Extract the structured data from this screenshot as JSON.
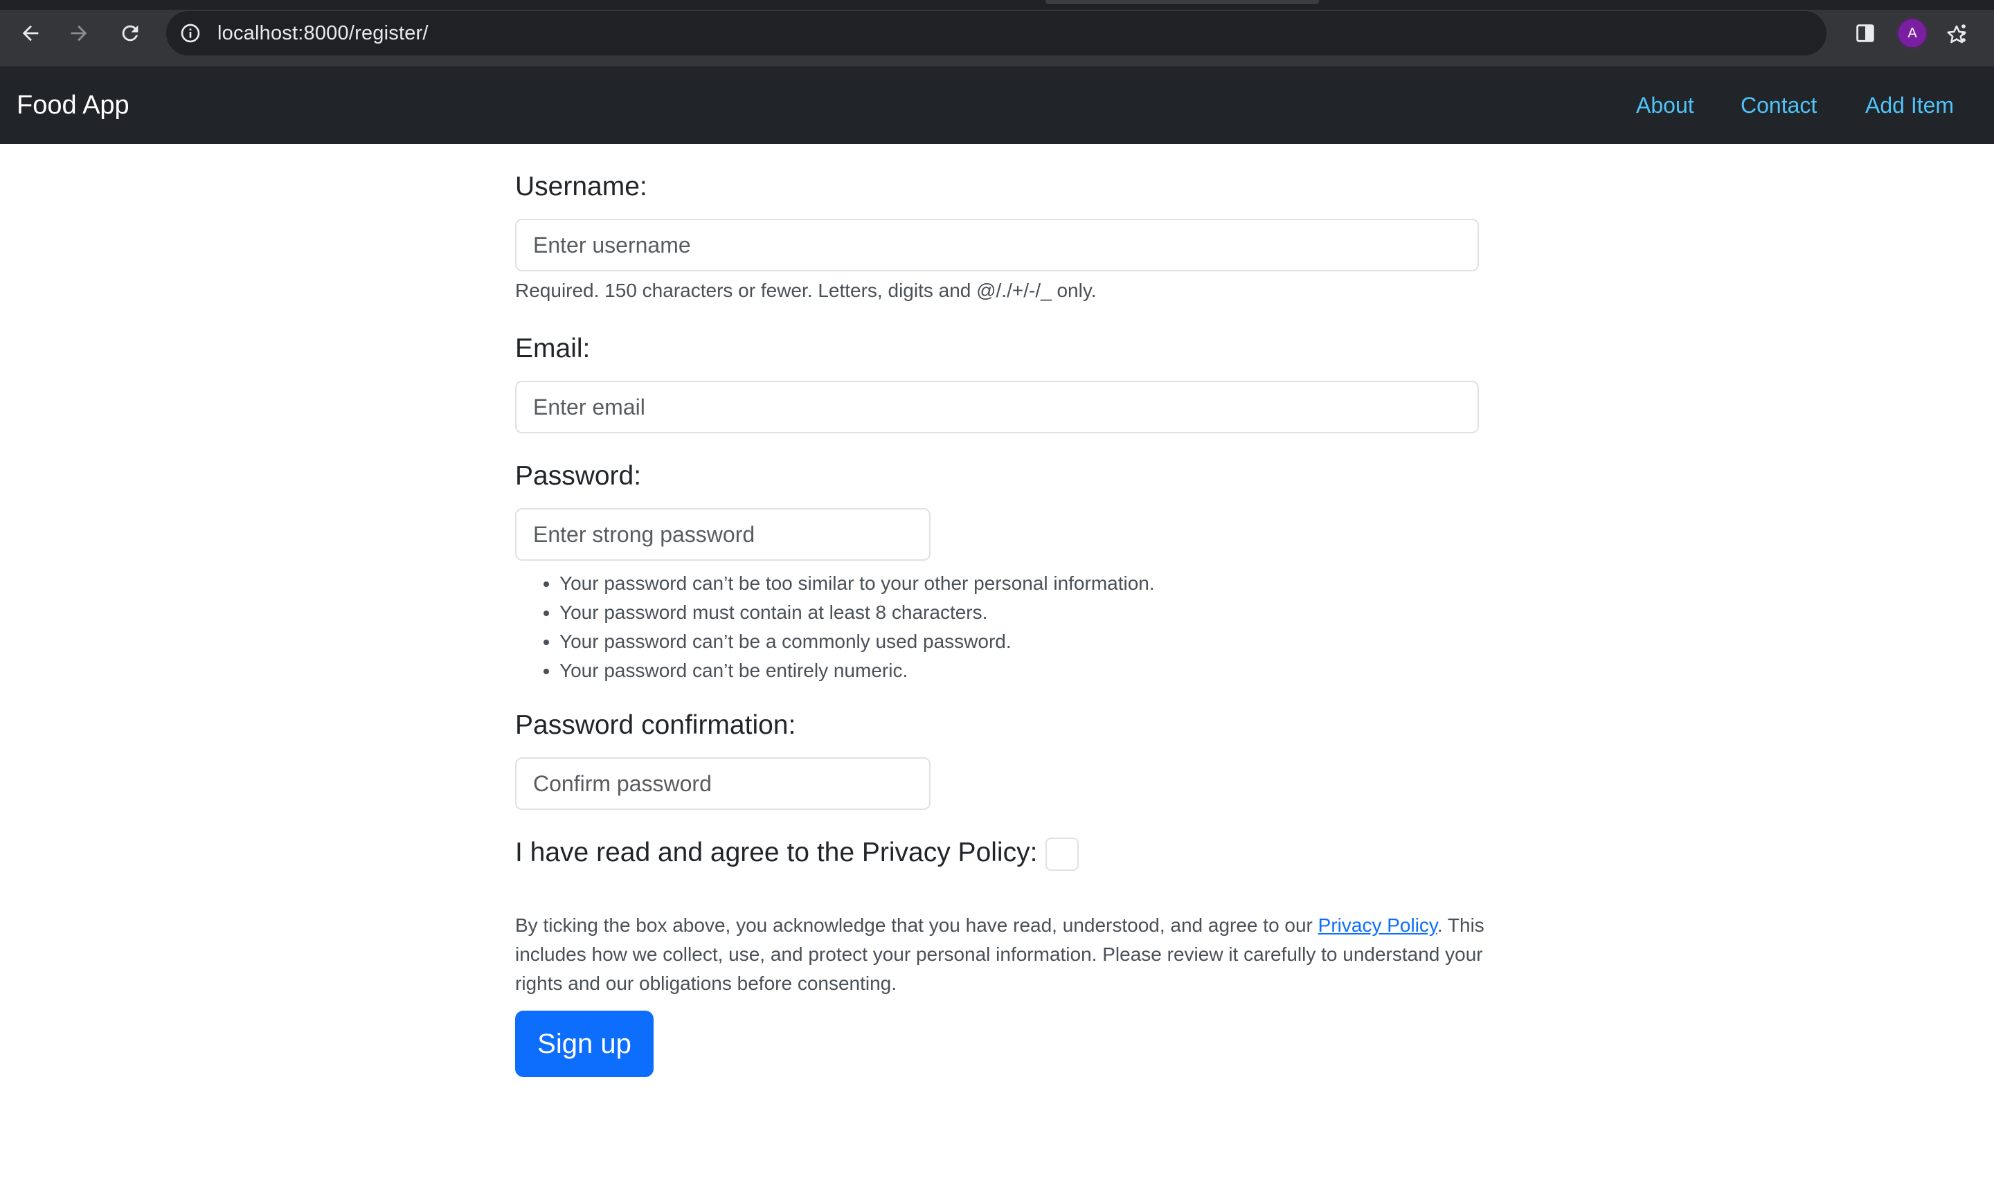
{
  "browser": {
    "url": "localhost:8000/register/",
    "profile_initial": "A"
  },
  "navbar": {
    "brand": "Food App",
    "links": [
      "About",
      "Contact",
      "Add Item"
    ],
    "link_color": "#4fc3f7",
    "background": "#212529"
  },
  "form": {
    "username": {
      "label": "Username:",
      "placeholder": "Enter username",
      "help": "Required. 150 characters or fewer. Letters, digits and @/./+/-/_ only."
    },
    "email": {
      "label": "Email:",
      "placeholder": "Enter email"
    },
    "password": {
      "label": "Password:",
      "placeholder": "Enter strong password",
      "rules": [
        "Your password can’t be too similar to your other personal information.",
        "Your password must contain at least 8 characters.",
        "Your password can’t be a commonly used password.",
        "Your password can’t be entirely numeric."
      ]
    },
    "password_confirm": {
      "label": "Password confirmation:",
      "placeholder": "Confirm password"
    },
    "privacy": {
      "label": "I have read and agree to the Privacy Policy:",
      "checked": false,
      "text_before": "By ticking the box above, you acknowledge that you have read, understood, and agree to our ",
      "link": "Privacy Policy",
      "text_after": ". This includes how we collect, use, and protect your personal information. Please review it carefully to understand your rights and our obligations before consenting."
    },
    "submit_label": "Sign up",
    "submit_color": "#0d6efd"
  }
}
